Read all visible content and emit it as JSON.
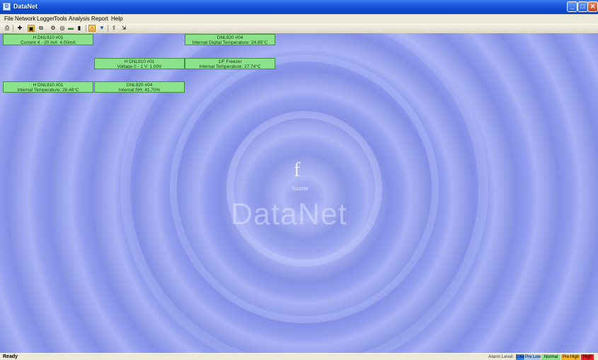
{
  "window": {
    "title": "DataNet",
    "app_icon_glyph": "D",
    "minimize_glyph": "_",
    "maximize_glyph": "□",
    "close_glyph": "✕"
  },
  "menu": {
    "items": [
      "File",
      "Network",
      "Logger",
      "Tools",
      "Analysis",
      "Report",
      "Help"
    ]
  },
  "toolbar": {
    "icons": [
      "print-icon",
      "add-icon",
      "logger-icon",
      "copy-icon",
      "settings-icon",
      "search-icon",
      "chart-icon",
      "battery-icon",
      "alarm-icon",
      "filter-icon",
      "upload-icon",
      "export-icon"
    ],
    "glyphs": [
      "⎙",
      "✚",
      "▣",
      "⧉",
      "⚙",
      "◎",
      "▬",
      "▮",
      "⚠",
      "▼",
      "⇪",
      "⇲"
    ]
  },
  "cards": [
    {
      "line1": "H DNL910 #01",
      "line2": "Current 4 - 20 mA: 4.00mA"
    },
    {
      "line1": "DNL920 #04",
      "line2": "Internal Digital Temperature: 24.85°C"
    },
    {
      "line1": "H DNL910 #01",
      "line2": "Voltage 0 - 1 V: 1.00V"
    },
    {
      "line1": "1/F Freezer",
      "line2": "Internal Temperature: 27.74°C"
    },
    {
      "line1": "H DNL910 #01",
      "line2": "Internal Temperature: 26.46°C"
    },
    {
      "line1": "DNL920 #04",
      "line2": "Internal RH: 41.70%"
    }
  ],
  "logo": {
    "mark": "f",
    "brand": "fourier",
    "product": "DataNet"
  },
  "status": {
    "text": "Ready",
    "alarm_label": "Alarm Level:",
    "levels": [
      {
        "label": "Low",
        "color": "#3a7fe0"
      },
      {
        "label": "Pre Low",
        "color": "#a8c8f4"
      },
      {
        "label": "Normal",
        "color": "#8ce28a"
      },
      {
        "label": "Pre High",
        "color": "#f2b52a"
      },
      {
        "label": "High",
        "color": "#e02020"
      }
    ]
  },
  "colors": {
    "card_fill": "#8ce28a",
    "titlebar": "#1a56d8",
    "background": "#8a96e8"
  }
}
